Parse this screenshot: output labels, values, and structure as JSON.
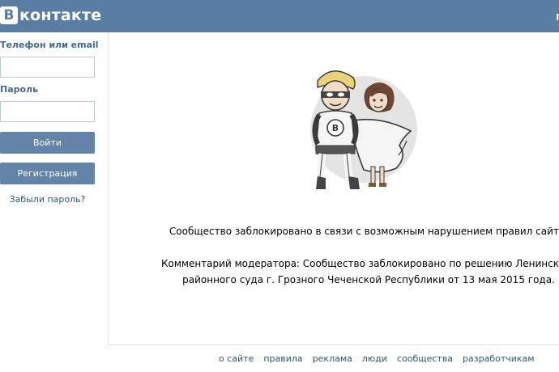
{
  "header": {
    "logo_letter": "B",
    "logo_text": "контакте",
    "right_link": "р",
    "colors": {
      "topbar": "#597da3",
      "link": "#2b587a",
      "button": "#6383a8"
    }
  },
  "login": {
    "login_label": "Телефон или email",
    "login_value": "",
    "password_label": "Пароль",
    "password_value": "",
    "login_button": "Войти",
    "register_button": "Регистрация",
    "forgot_link": "Забыли пароль?"
  },
  "main": {
    "illustration": "superhero-couple-illustration",
    "blocked_message": "Сообщество заблокировано в связи с возможным нарушением правил сайта.",
    "moderator_comment": "Комментарий модератора: Сообщество заблокировано по решению Ленинского районного суда г. Грозного Чеченской Республики от 13 мая 2015 года."
  },
  "footer": {
    "links": [
      "о сайте",
      "правила",
      "реклама",
      "люди",
      "сообщества",
      "разработчикам"
    ]
  }
}
